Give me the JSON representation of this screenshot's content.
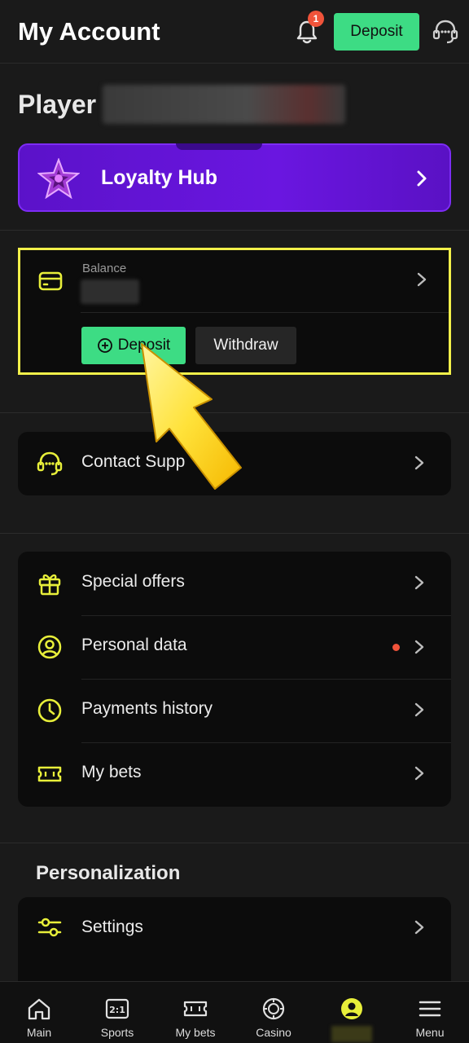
{
  "header": {
    "title": "My Account",
    "notification_count": "1",
    "deposit_label": "Deposit"
  },
  "player": {
    "label": "Player"
  },
  "loyalty": {
    "title": "Loyalty Hub"
  },
  "balance": {
    "label": "Balance",
    "deposit_label": "Deposit",
    "withdraw_label": "Withdraw"
  },
  "support": {
    "label": "Contact Supp"
  },
  "menu": {
    "items": [
      {
        "label": "Special offers",
        "icon": "gift-icon"
      },
      {
        "label": "Personal data",
        "icon": "user-circle-icon",
        "has_dot": true
      },
      {
        "label": "Payments history",
        "icon": "clock-icon"
      },
      {
        "label": "My bets",
        "icon": "ticket-icon"
      }
    ]
  },
  "personalization": {
    "title": "Personalization",
    "settings_label": "Settings"
  },
  "bottom_nav": {
    "items": [
      {
        "label": "Main",
        "icon": "home-icon"
      },
      {
        "label": "Sports",
        "icon": "scoreboard-icon"
      },
      {
        "label": "My bets",
        "icon": "ticket-icon"
      },
      {
        "label": "Casino",
        "icon": "casino-chip-icon"
      },
      {
        "label": "",
        "icon": "account-icon"
      },
      {
        "label": "Menu",
        "icon": "hamburger-icon"
      }
    ]
  },
  "colors": {
    "accent_yellow": "#e8ef3a",
    "deposit_green": "#3ddc84",
    "loyalty_purple": "#6a16e0",
    "notification_red": "#f0533a",
    "background": "#1a1a1a"
  }
}
